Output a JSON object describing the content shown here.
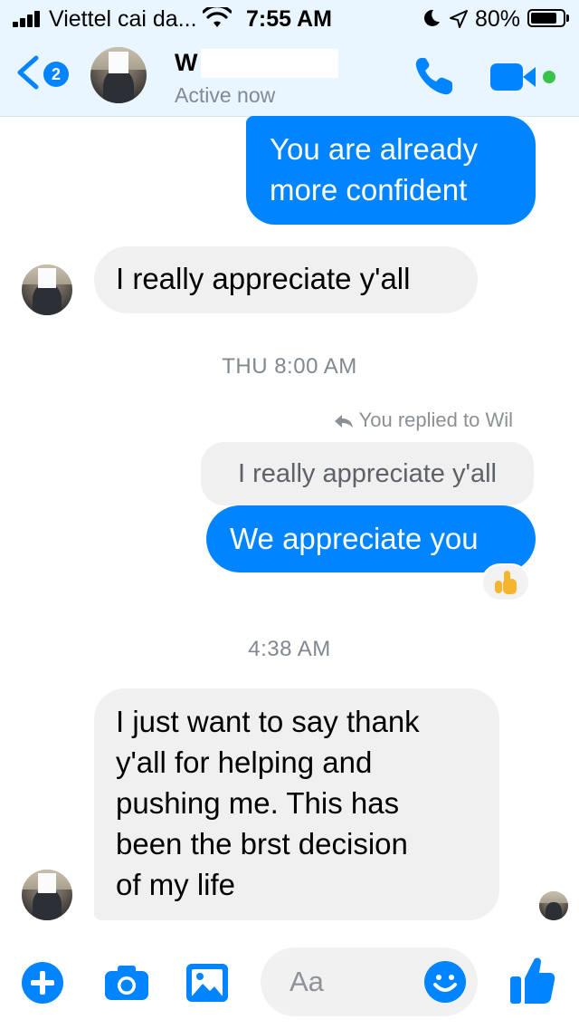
{
  "status_bar": {
    "carrier": "Viettel cai da...",
    "time": "7:55 AM",
    "battery_percent": "80%",
    "battery_level": 0.8
  },
  "header": {
    "back_badge": "2",
    "contact_name": "W",
    "status": "Active now",
    "icons": [
      "back-chevron-icon",
      "phone-icon",
      "video-camera-icon",
      "online-dot-icon"
    ]
  },
  "messages": {
    "m1": {
      "sender": "me",
      "text_line1": "You are already",
      "text_line2": "more confident"
    },
    "m2": {
      "sender": "them",
      "text": "I really appreciate y'all"
    },
    "ts1": "THU 8:00 AM",
    "reply_note": "You replied to Wil",
    "quoted": "I really appreciate y'all",
    "m3": {
      "sender": "me",
      "text": "We appreciate you",
      "reaction": "thumbs-up"
    },
    "ts2": "4:38 AM",
    "m4": {
      "sender": "them",
      "lines": [
        "I just want to say thank",
        "y'all for helping and",
        "pushing me. This has",
        "been the brst decision",
        "of my life"
      ]
    }
  },
  "composer": {
    "placeholder": "Aa",
    "icons": [
      "plus-icon",
      "camera-icon",
      "gallery-icon",
      "emoji-icon",
      "like-icon"
    ]
  },
  "colors": {
    "accent": "#0084ff",
    "incoming_bubble": "#f0f0f0",
    "online": "#3ac34a",
    "header_bg": "#eaf6ff"
  }
}
